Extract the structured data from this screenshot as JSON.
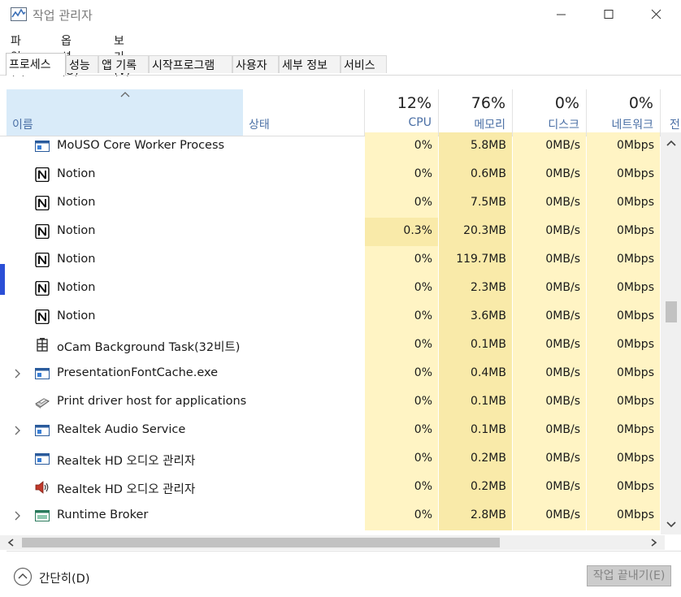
{
  "window": {
    "title": "작업 관리자"
  },
  "menu": [
    "파일(F)",
    "옵션(O)",
    "보기(V)"
  ],
  "tabs": [
    "프로세스",
    "성능",
    "앱 기록",
    "시작프로그램",
    "사용자",
    "세부 정보",
    "서비스"
  ],
  "header": {
    "name": "이름",
    "status": "상태",
    "cpu_pct": "12%",
    "cpu_label": "CPU",
    "mem_pct": "76%",
    "mem_label": "메모리",
    "disk_pct": "0%",
    "disk_label": "디스크",
    "net_pct": "0%",
    "net_label": "네트워크",
    "power_label": "전"
  },
  "processes": [
    {
      "name": "MoUSO Core Worker Process",
      "icon": "window-app-icon",
      "cpu": "0%",
      "mem": "5.8MB",
      "disk": "0MB/s",
      "net": "0Mbps"
    },
    {
      "name": "Notion",
      "icon": "notion-icon",
      "cpu": "0%",
      "mem": "0.6MB",
      "disk": "0MB/s",
      "net": "0Mbps"
    },
    {
      "name": "Notion",
      "icon": "notion-icon",
      "cpu": "0%",
      "mem": "7.5MB",
      "disk": "0MB/s",
      "net": "0Mbps"
    },
    {
      "name": "Notion",
      "icon": "notion-icon",
      "cpu": "0.3%",
      "mem": "20.3MB",
      "disk": "0MB/s",
      "net": "0Mbps"
    },
    {
      "name": "Notion",
      "icon": "notion-icon",
      "cpu": "0%",
      "mem": "119.7MB",
      "disk": "0MB/s",
      "net": "0Mbps"
    },
    {
      "name": "Notion",
      "icon": "notion-icon",
      "cpu": "0%",
      "mem": "2.3MB",
      "disk": "0MB/s",
      "net": "0Mbps"
    },
    {
      "name": "Notion",
      "icon": "notion-icon",
      "cpu": "0%",
      "mem": "3.6MB",
      "disk": "0MB/s",
      "net": "0Mbps"
    },
    {
      "name": "oCam Background Task(32비트)",
      "icon": "ocam-icon",
      "cpu": "0%",
      "mem": "0.1MB",
      "disk": "0MB/s",
      "net": "0Mbps"
    },
    {
      "name": "PresentationFontCache.exe",
      "icon": "window-app-icon",
      "cpu": "0%",
      "mem": "0.4MB",
      "disk": "0MB/s",
      "net": "0Mbps"
    },
    {
      "name": "Print driver host for applications",
      "icon": "printer-icon",
      "cpu": "0%",
      "mem": "0.1MB",
      "disk": "0MB/s",
      "net": "0Mbps"
    },
    {
      "name": "Realtek Audio Service",
      "icon": "window-app-icon",
      "cpu": "0%",
      "mem": "0.1MB",
      "disk": "0MB/s",
      "net": "0Mbps"
    },
    {
      "name": "Realtek HD 오디오 관리자",
      "icon": "window-app-icon",
      "cpu": "0%",
      "mem": "0.2MB",
      "disk": "0MB/s",
      "net": "0Mbps"
    },
    {
      "name": "Realtek HD 오디오 관리자",
      "icon": "speaker-icon",
      "cpu": "0%",
      "mem": "0.2MB",
      "disk": "0MB/s",
      "net": "0Mbps"
    },
    {
      "name": "Runtime Broker",
      "icon": "window-app-icon",
      "cpu": "0%",
      "mem": "2.8MB",
      "disk": "0MB/s",
      "net": "0Mbps"
    }
  ],
  "footer": {
    "collapse_label": "간단히(D)",
    "end_task_label": "작업 끝내기(E)"
  }
}
